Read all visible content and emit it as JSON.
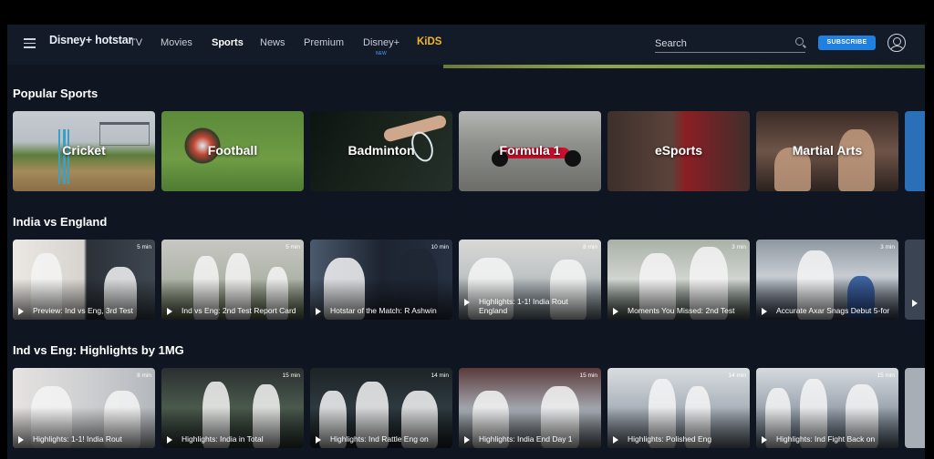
{
  "nav": {
    "logo_text": "Disney+ hotstar",
    "links": [
      "TV",
      "Movies",
      "Sports",
      "News",
      "Premium",
      "Disney+",
      "KiDS"
    ],
    "active": "Sports",
    "new_badge": "NEW",
    "search_placeholder": "Search",
    "subscribe": "SUBSCRIBE"
  },
  "sections": {
    "popular": {
      "title": "Popular Sports",
      "tiles": [
        "Cricket",
        "Football",
        "Badminton",
        "Formula 1",
        "eSports",
        "Martial Arts"
      ]
    },
    "india_england": {
      "title": "India vs England",
      "videos": [
        {
          "duration": "5 min",
          "title": "Preview: Ind vs Eng, 3rd Test"
        },
        {
          "duration": "5 min",
          "title": "Ind vs Eng: 2nd Test Report Card"
        },
        {
          "duration": "10 min",
          "title": "Hotstar of the Match: R Ashwin"
        },
        {
          "duration": "8 min",
          "title": "Highlights: 1-1! India Rout England"
        },
        {
          "duration": "3 min",
          "title": "Moments You Missed: 2nd Test"
        },
        {
          "duration": "3 min",
          "title": "Accurate Axar Snags Debut 5-for"
        }
      ]
    },
    "highlights_1mg": {
      "title": "Ind vs Eng: Highlights by 1MG",
      "videos": [
        {
          "duration": "8 min",
          "title": "Highlights: 1-1! India Rout"
        },
        {
          "duration": "15 min",
          "title": "Highlights: India in Total"
        },
        {
          "duration": "14 min",
          "title": "Highlights: Ind Rattle Eng on"
        },
        {
          "duration": "15 min",
          "title": "Highlights: India End Day 1"
        },
        {
          "duration": "14 min",
          "title": "Highlights: Polished Eng"
        },
        {
          "duration": "15 min",
          "title": "Highlights: Ind Fight Back on"
        }
      ]
    }
  },
  "colors": {
    "background": "#0f1622",
    "nav": "#131a28",
    "subscribe": "#1f80e0",
    "kids": "#f3b822"
  }
}
